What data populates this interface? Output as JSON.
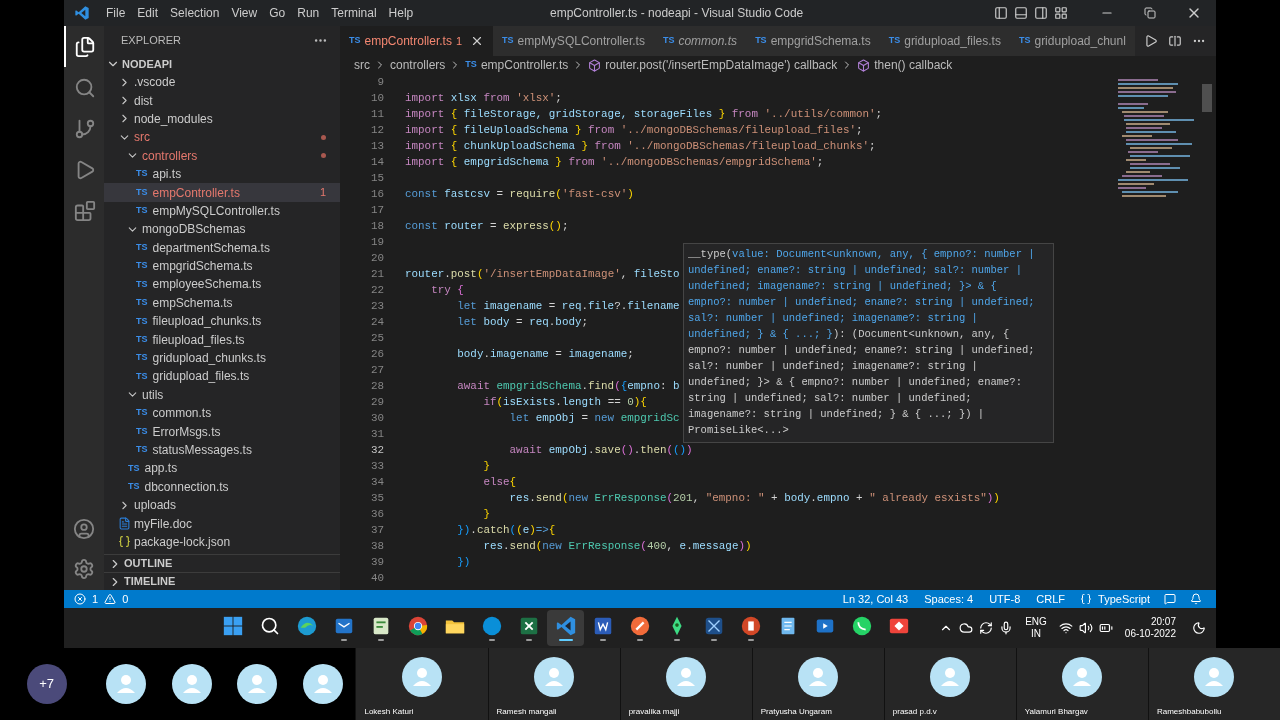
{
  "window": {
    "title": "empController.ts - nodeapi - Visual Studio Code",
    "menu": [
      "File",
      "Edit",
      "Selection",
      "View",
      "Go",
      "Run",
      "Terminal",
      "Help"
    ]
  },
  "activity_bar": [
    {
      "kind": "explorer",
      "selected": true
    },
    {
      "kind": "search",
      "selected": false
    },
    {
      "kind": "source-control",
      "selected": false
    },
    {
      "kind": "run-debug",
      "selected": false
    },
    {
      "kind": "extensions",
      "selected": false
    }
  ],
  "sidebar": {
    "title": "EXPLORER",
    "section": "NODEAPI",
    "tree": [
      {
        "name": ".vscode",
        "kind": "folder",
        "expanded": false,
        "selected": false,
        "error": false
      },
      {
        "name": "dist",
        "kind": "folder",
        "expanded": false,
        "selected": false,
        "error": false
      },
      {
        "name": "node_modules",
        "kind": "folder",
        "expanded": false,
        "selected": false,
        "error": false
      },
      {
        "name": "src",
        "kind": "folder",
        "expanded": true,
        "selected": false,
        "error": true,
        "children": [
          {
            "name": "controllers",
            "kind": "folder",
            "expanded": true,
            "selected": false,
            "error": true,
            "children": [
              {
                "name": "api.ts",
                "kind": "ts",
                "icon_text": "TS",
                "selected": false,
                "error": false
              },
              {
                "name": "empController.ts",
                "kind": "ts",
                "icon_text": "TS",
                "selected": true,
                "error": true,
                "count": "1"
              },
              {
                "name": "empMySQLController.ts",
                "kind": "ts",
                "icon_text": "TS",
                "selected": false,
                "error": false
              }
            ]
          },
          {
            "name": "mongoDBSchemas",
            "kind": "folder",
            "expanded": true,
            "selected": false,
            "error": false,
            "children": [
              {
                "name": "departmentSchema.ts",
                "kind": "ts",
                "icon_text": "TS",
                "selected": false,
                "error": false
              },
              {
                "name": "empgridSchema.ts",
                "kind": "ts",
                "icon_text": "TS",
                "selected": false,
                "error": false
              },
              {
                "name": "employeeSchema.ts",
                "kind": "ts",
                "icon_text": "TS",
                "selected": false,
                "error": false
              },
              {
                "name": "empSchema.ts",
                "kind": "ts",
                "icon_text": "TS",
                "selected": false,
                "error": false
              },
              {
                "name": "fileupload_chunks.ts",
                "kind": "ts",
                "icon_text": "TS",
                "selected": false,
                "error": false
              },
              {
                "name": "fileupload_files.ts",
                "kind": "ts",
                "icon_text": "TS",
                "selected": false,
                "error": false
              },
              {
                "name": "gridupload_chunks.ts",
                "kind": "ts",
                "icon_text": "TS",
                "selected": false,
                "error": false
              },
              {
                "name": "gridupload_files.ts",
                "kind": "ts",
                "icon_text": "TS",
                "selected": false,
                "error": false
              }
            ]
          },
          {
            "name": "utils",
            "kind": "folder",
            "expanded": true,
            "selected": false,
            "error": false,
            "children": [
              {
                "name": "common.ts",
                "kind": "ts",
                "icon_text": "TS",
                "selected": false,
                "error": false
              },
              {
                "name": "ErrorMsgs.ts",
                "kind": "ts",
                "icon_text": "TS",
                "selected": false,
                "error": false
              },
              {
                "name": "statusMessages.ts",
                "kind": "ts",
                "icon_text": "TS",
                "selected": false,
                "error": false
              }
            ]
          },
          {
            "name": "app.ts",
            "kind": "ts",
            "icon_text": "TS",
            "selected": false,
            "error": false
          },
          {
            "name": "dbconnection.ts",
            "kind": "ts",
            "icon_text": "TS",
            "selected": false,
            "error": false
          }
        ]
      },
      {
        "name": "uploads",
        "kind": "folder",
        "expanded": false,
        "selected": false,
        "error": false
      },
      {
        "name": "myFile.doc",
        "kind": "doc",
        "selected": false,
        "error": false
      },
      {
        "name": "package-lock.json",
        "kind": "json",
        "selected": false,
        "error": false
      }
    ],
    "panels": [
      {
        "title": "OUTLINE",
        "expanded": false
      },
      {
        "title": "TIMELINE",
        "expanded": false
      }
    ]
  },
  "tabs": [
    {
      "icon_text": "TS",
      "label": "empController.ts",
      "count": "1",
      "selected": true,
      "error": true,
      "preview": false
    },
    {
      "icon_text": "TS",
      "label": "empMySQLController.ts",
      "selected": false,
      "error": false,
      "preview": false
    },
    {
      "icon_text": "TS",
      "label": "common.ts",
      "selected": false,
      "error": false,
      "preview": true
    },
    {
      "icon_text": "TS",
      "label": "empgridSchema.ts",
      "selected": false,
      "error": false,
      "preview": false
    },
    {
      "icon_text": "TS",
      "label": "gridupload_files.ts",
      "selected": false,
      "error": false,
      "preview": false
    },
    {
      "icon_text": "TS",
      "label": "gridupload_chunl",
      "selected": false,
      "error": false,
      "preview": false
    }
  ],
  "breadcrumb": [
    {
      "kind": "folder",
      "text": "src"
    },
    {
      "kind": "folder",
      "text": "controllers"
    },
    {
      "kind": "file",
      "icon_text": "TS",
      "text": "empController.ts"
    },
    {
      "kind": "symbol",
      "text": "router.post('/insertEmpDataImage') callback"
    },
    {
      "kind": "symbol",
      "text": "then() callback"
    }
  ],
  "editor": {
    "lines": [
      {
        "number": "9",
        "current": false
      },
      {
        "number": "10",
        "current": false,
        "tokens": [
          {
            "kind": "keyword",
            "text": "import"
          },
          {
            "kind": "variable",
            "text": " xlsx "
          },
          {
            "kind": "keyword",
            "text": "from"
          },
          {
            "kind": "string",
            "text": " 'xlsx'"
          },
          {
            "kind": "plain",
            "text": ";"
          }
        ]
      },
      {
        "number": "11",
        "current": false,
        "tokens": [
          {
            "kind": "keyword",
            "text": "import "
          },
          {
            "kind": "bracket1",
            "text": "{"
          },
          {
            "kind": "variable",
            "text": " fileStorage, gridStorage, storageFiles "
          },
          {
            "kind": "bracket1",
            "text": "}"
          },
          {
            "kind": "keyword",
            "text": " from"
          },
          {
            "kind": "string",
            "text": " '../utils/common'"
          },
          {
            "kind": "plain",
            "text": ";"
          }
        ]
      },
      {
        "number": "12",
        "current": false,
        "tokens": [
          {
            "kind": "keyword",
            "text": "import "
          },
          {
            "kind": "bracket1",
            "text": "{"
          },
          {
            "kind": "variable",
            "text": " fileUploadSchema "
          },
          {
            "kind": "bracket1",
            "text": "}"
          },
          {
            "kind": "keyword",
            "text": " from"
          },
          {
            "kind": "string",
            "text": " '../mongoDBSchemas/fileupload_files'"
          },
          {
            "kind": "plain",
            "text": ";"
          }
        ]
      },
      {
        "number": "13",
        "current": false,
        "tokens": [
          {
            "kind": "keyword",
            "text": "import "
          },
          {
            "kind": "bracket1",
            "text": "{"
          },
          {
            "kind": "variable",
            "text": " chunkUploadSchema "
          },
          {
            "kind": "bracket1",
            "text": "}"
          },
          {
            "kind": "keyword",
            "text": " from"
          },
          {
            "kind": "string",
            "text": " '../mongoDBSchemas/fileupload_chunks'"
          },
          {
            "kind": "plain",
            "text": ";"
          }
        ]
      },
      {
        "number": "14",
        "current": false,
        "tokens": [
          {
            "kind": "keyword",
            "text": "import "
          },
          {
            "kind": "bracket1",
            "text": "{"
          },
          {
            "kind": "variable",
            "text": " empgridSchema "
          },
          {
            "kind": "bracket1",
            "text": "}"
          },
          {
            "kind": "keyword",
            "text": " from"
          },
          {
            "kind": "string",
            "text": " '../mongoDBSchemas/empgridSchema'"
          },
          {
            "kind": "plain",
            "text": ";"
          }
        ]
      },
      {
        "number": "15",
        "current": false
      },
      {
        "number": "16",
        "current": false,
        "tokens": [
          {
            "kind": "storage",
            "text": "const"
          },
          {
            "kind": "variable",
            "text": " fastcsv"
          },
          {
            "kind": "plain",
            "text": " = "
          },
          {
            "kind": "function",
            "text": "require"
          },
          {
            "kind": "bracket1",
            "text": "("
          },
          {
            "kind": "string",
            "text": "'fast-csv'"
          },
          {
            "kind": "bracket1",
            "text": ")"
          }
        ]
      },
      {
        "number": "17",
        "current": false
      },
      {
        "number": "18",
        "current": false,
        "tokens": [
          {
            "kind": "storage",
            "text": "const"
          },
          {
            "kind": "variable",
            "text": " router"
          },
          {
            "kind": "plain",
            "text": " = "
          },
          {
            "kind": "function",
            "text": "express"
          },
          {
            "kind": "bracket1",
            "text": "()"
          },
          {
            "kind": "plain",
            "text": ";"
          }
        ]
      },
      {
        "number": "19",
        "current": false
      },
      {
        "number": "20",
        "current": false
      },
      {
        "number": "21",
        "current": false,
        "tokens": [
          {
            "kind": "variable",
            "text": "router"
          },
          {
            "kind": "plain",
            "text": "."
          },
          {
            "kind": "function",
            "text": "post"
          },
          {
            "kind": "bracket1",
            "text": "("
          },
          {
            "kind": "string",
            "text": "'/insertEmpDataImage'"
          },
          {
            "kind": "plain",
            "text": ", "
          },
          {
            "kind": "variable",
            "text": "fileSto"
          }
        ]
      },
      {
        "number": "22",
        "current": false,
        "tokens": [
          {
            "kind": "keyword",
            "text": "    try "
          },
          {
            "kind": "bracket2",
            "text": "{"
          }
        ]
      },
      {
        "number": "23",
        "current": false,
        "tokens": [
          {
            "kind": "storage",
            "text": "        let"
          },
          {
            "kind": "variable",
            "text": " imagename"
          },
          {
            "kind": "plain",
            "text": " = "
          },
          {
            "kind": "variable",
            "text": "req"
          },
          {
            "kind": "plain",
            "text": "."
          },
          {
            "kind": "variable",
            "text": "file"
          },
          {
            "kind": "plain",
            "text": "?."
          },
          {
            "kind": "variable",
            "text": "filename"
          }
        ]
      },
      {
        "number": "24",
        "current": false,
        "tokens": [
          {
            "kind": "storage",
            "text": "        let"
          },
          {
            "kind": "variable",
            "text": " body"
          },
          {
            "kind": "plain",
            "text": " = "
          },
          {
            "kind": "variable",
            "text": "req"
          },
          {
            "kind": "plain",
            "text": "."
          },
          {
            "kind": "variable",
            "text": "body"
          },
          {
            "kind": "plain",
            "text": ";"
          }
        ]
      },
      {
        "number": "25",
        "current": false
      },
      {
        "number": "26",
        "current": false,
        "tokens": [
          {
            "kind": "variable",
            "text": "        body"
          },
          {
            "kind": "plain",
            "text": "."
          },
          {
            "kind": "variable",
            "text": "imagename"
          },
          {
            "kind": "plain",
            "text": " = "
          },
          {
            "kind": "variable",
            "text": "imagename"
          },
          {
            "kind": "plain",
            "text": ";"
          }
        ]
      },
      {
        "number": "27",
        "current": false
      },
      {
        "number": "28",
        "current": false,
        "tokens": [
          {
            "kind": "keyword",
            "text": "        await"
          },
          {
            "kind": "class",
            "text": " empgridSchema"
          },
          {
            "kind": "plain",
            "text": "."
          },
          {
            "kind": "function",
            "text": "find"
          },
          {
            "kind": "bracket2",
            "text": "("
          },
          {
            "kind": "bracket3",
            "text": "{"
          },
          {
            "kind": "variable",
            "text": "empno"
          },
          {
            "kind": "plain",
            "text": ": "
          },
          {
            "kind": "variable",
            "text": "b"
          }
        ]
      },
      {
        "number": "29",
        "current": false,
        "tokens": [
          {
            "kind": "keyword",
            "text": "            if"
          },
          {
            "kind": "bracket1",
            "text": "("
          },
          {
            "kind": "variable",
            "text": "isExists"
          },
          {
            "kind": "plain",
            "text": "."
          },
          {
            "kind": "variable",
            "text": "length"
          },
          {
            "kind": "plain",
            "text": " == "
          },
          {
            "kind": "number",
            "text": "0"
          },
          {
            "kind": "bracket1",
            "text": "){"
          }
        ]
      },
      {
        "number": "30",
        "current": false,
        "tokens": [
          {
            "kind": "storage",
            "text": "                let"
          },
          {
            "kind": "variable",
            "text": " empObj"
          },
          {
            "kind": "plain",
            "text": " = "
          },
          {
            "kind": "storage",
            "text": "new"
          },
          {
            "kind": "class",
            "text": " empgridSc"
          }
        ]
      },
      {
        "number": "31",
        "current": false
      },
      {
        "number": "32",
        "current": true,
        "tokens": [
          {
            "kind": "keyword",
            "text": "                await"
          },
          {
            "kind": "variable",
            "text": " empObj"
          },
          {
            "kind": "plain",
            "text": "."
          },
          {
            "kind": "function",
            "text": "save"
          },
          {
            "kind": "bracket2",
            "text": "()"
          },
          {
            "kind": "plain",
            "text": "."
          },
          {
            "kind": "function",
            "text": "then"
          },
          {
            "kind": "bracket2",
            "text": "("
          },
          {
            "kind": "bracket3",
            "text": "()"
          },
          {
            "kind": "bracket2",
            "text": ")"
          }
        ]
      },
      {
        "number": "33",
        "current": false,
        "tokens": [
          {
            "kind": "bracket1",
            "text": "            }"
          }
        ]
      },
      {
        "number": "34",
        "current": false,
        "tokens": [
          {
            "kind": "keyword",
            "text": "            else"
          },
          {
            "kind": "bracket1",
            "text": "{"
          }
        ]
      },
      {
        "number": "35",
        "current": false,
        "tokens": [
          {
            "kind": "variable",
            "text": "                res"
          },
          {
            "kind": "plain",
            "text": "."
          },
          {
            "kind": "function",
            "text": "send"
          },
          {
            "kind": "bracket1",
            "text": "("
          },
          {
            "kind": "storage",
            "text": "new "
          },
          {
            "kind": "class",
            "text": "ErrResponse"
          },
          {
            "kind": "bracket2",
            "text": "("
          },
          {
            "kind": "number",
            "text": "201"
          },
          {
            "kind": "plain",
            "text": ", "
          },
          {
            "kind": "string",
            "text": "\"empno: \""
          },
          {
            "kind": "plain",
            "text": " + "
          },
          {
            "kind": "variable",
            "text": "body"
          },
          {
            "kind": "plain",
            "text": "."
          },
          {
            "kind": "variable",
            "text": "empno"
          },
          {
            "kind": "plain",
            "text": " + "
          },
          {
            "kind": "string",
            "text": "\" already esxists\""
          },
          {
            "kind": "bracket2",
            "text": ")"
          },
          {
            "kind": "bracket1",
            "text": ")"
          }
        ]
      },
      {
        "number": "36",
        "current": false,
        "tokens": [
          {
            "kind": "bracket1",
            "text": "            }"
          }
        ]
      },
      {
        "number": "37",
        "current": false,
        "tokens": [
          {
            "kind": "bracket3",
            "text": "        })"
          },
          {
            "kind": "plain",
            "text": "."
          },
          {
            "kind": "function",
            "text": "catch"
          },
          {
            "kind": "bracket3",
            "text": "("
          },
          {
            "kind": "bracket1",
            "text": "("
          },
          {
            "kind": "variable",
            "text": "e"
          },
          {
            "kind": "bracket1",
            "text": ")"
          },
          {
            "kind": "storage",
            "text": "=>"
          },
          {
            "kind": "bracket1",
            "text": "{"
          }
        ]
      },
      {
        "number": "38",
        "current": false,
        "tokens": [
          {
            "kind": "variable",
            "text": "            res"
          },
          {
            "kind": "plain",
            "text": "."
          },
          {
            "kind": "function",
            "text": "send"
          },
          {
            "kind": "bracket1",
            "text": "("
          },
          {
            "kind": "storage",
            "text": "new "
          },
          {
            "kind": "class",
            "text": "ErrResponse"
          },
          {
            "kind": "bracket2",
            "text": "("
          },
          {
            "kind": "number",
            "text": "400"
          },
          {
            "kind": "plain",
            "text": ", "
          },
          {
            "kind": "variable",
            "text": "e"
          },
          {
            "kind": "plain",
            "text": "."
          },
          {
            "kind": "variable",
            "text": "message"
          },
          {
            "kind": "bracket2",
            "text": ")"
          },
          {
            "kind": "bracket1",
            "text": ")"
          }
        ]
      },
      {
        "number": "39",
        "current": false,
        "tokens": [
          {
            "kind": "bracket3",
            "text": "        })"
          }
        ]
      },
      {
        "number": "40",
        "current": false
      }
    ],
    "hover": {
      "lines": [
        [
          {
            "text": "__type(",
            "highlighted": false
          },
          {
            "text": "value: Document<unknown, any, { empno?: number |",
            "highlighted": true
          }
        ],
        [
          {
            "text": "undefined; ename?: string | undefined; sal?: number |",
            "highlighted": true
          }
        ],
        [
          {
            "text": "undefined; imagename?: string | undefined; }> & {",
            "highlighted": true
          }
        ],
        [
          {
            "text": "empno?: number | undefined; ename?: string | undefined;",
            "highlighted": true
          }
        ],
        [
          {
            "text": "sal?: number | undefined; imagename?: string |",
            "highlighted": true
          }
        ],
        [
          {
            "text": "undefined; } & { ...; }",
            "highlighted": true
          },
          {
            "text": "): (Document<unknown, any, {",
            "highlighted": false
          }
        ],
        [
          {
            "text": "empno?: number | undefined; ename?: string | undefined;",
            "highlighted": false
          }
        ],
        [
          {
            "text": "sal?: number | undefined; imagename?: string |",
            "highlighted": false
          }
        ],
        [
          {
            "text": "undefined; }> & { empno?: number | undefined; ename?:",
            "highlighted": false
          }
        ],
        [
          {
            "text": "string | undefined; sal?: number | undefined;",
            "highlighted": false
          }
        ],
        [
          {
            "text": "imagename?: string | undefined; } & { ...; }) |",
            "highlighted": false
          }
        ],
        [
          {
            "text": "PromiseLike<...>",
            "highlighted": false
          }
        ]
      ]
    }
  },
  "status_bar": {
    "errors": "1",
    "warnings": "0",
    "items": [
      "Ln 32, Col 43",
      "Spaces: 4",
      "UTF-8",
      "CRLF"
    ],
    "language": "TypeScript"
  },
  "taskbar": {
    "apps": [
      {
        "kind": "windows",
        "running": false,
        "selected": false
      },
      {
        "kind": "search",
        "running": false,
        "selected": false
      },
      {
        "kind": "edge",
        "running": false,
        "selected": false
      },
      {
        "kind": "outlook",
        "running": true,
        "selected": false
      },
      {
        "kind": "planner",
        "running": true,
        "selected": false
      },
      {
        "kind": "chrome",
        "running": false,
        "selected": false
      },
      {
        "kind": "folder",
        "running": false,
        "selected": false
      },
      {
        "kind": "skype",
        "running": true,
        "selected": false
      },
      {
        "kind": "excel",
        "running": true,
        "selected": false
      },
      {
        "kind": "vscode",
        "running": true,
        "selected": true
      },
      {
        "kind": "word",
        "running": true,
        "selected": false
      },
      {
        "kind": "brave",
        "running": true,
        "selected": false
      },
      {
        "kind": "android",
        "running": true,
        "selected": false
      },
      {
        "kind": "snip",
        "running": true,
        "selected": false
      },
      {
        "kind": "powerpoint",
        "running": true,
        "selected": false
      },
      {
        "kind": "notepad",
        "running": false,
        "selected": false
      },
      {
        "kind": "movies",
        "running": false,
        "selected": false
      },
      {
        "kind": "whatsapp",
        "running": false,
        "selected": false
      },
      {
        "kind": "anydesk",
        "running": false,
        "selected": false
      }
    ],
    "language": "ENG",
    "region": "IN",
    "time": "20:07",
    "date": "06-10-2022"
  },
  "meeting": {
    "overflow": "+7",
    "participants": [
      {
        "kind": "avatar"
      },
      {
        "kind": "avatar"
      },
      {
        "kind": "avatar"
      },
      {
        "kind": "avatar"
      },
      {
        "kind": "tile",
        "name": "Lokesh Katuri"
      },
      {
        "kind": "tile",
        "name": "Ramesh mangali"
      },
      {
        "kind": "tile",
        "name": "pravalika majji"
      },
      {
        "kind": "tile",
        "name": "Pratyusha Ungaram"
      },
      {
        "kind": "tile",
        "name": "prasad p.d.v"
      },
      {
        "kind": "tile",
        "name": "Yalamuri Bhargav"
      },
      {
        "kind": "tile",
        "name": "Rameshbabubollu"
      }
    ]
  }
}
